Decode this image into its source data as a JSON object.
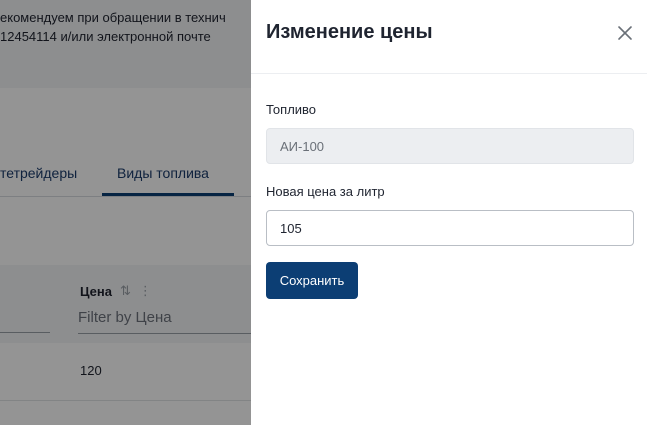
{
  "background": {
    "notice_line1": "екомендуем при обращении в технич",
    "notice_line2": "12454114 и/или электронной почте",
    "tabs": [
      {
        "label": "тетрейдеры"
      },
      {
        "label": "Виды топлива",
        "active": true
      }
    ],
    "table": {
      "column_price": "Цена",
      "filter_price_placeholder": "Filter by Цена",
      "rows": [
        {
          "price": "120"
        }
      ]
    }
  },
  "drawer": {
    "title": "Изменение цены",
    "fuel_label": "Топливо",
    "fuel_value": "АИ-100",
    "price_label": "Новая цена за литр",
    "price_value": "105",
    "save_label": "Сохранить"
  },
  "colors": {
    "primary": "#0c3e74",
    "overlay": "rgba(0,0,0,0.42)"
  }
}
